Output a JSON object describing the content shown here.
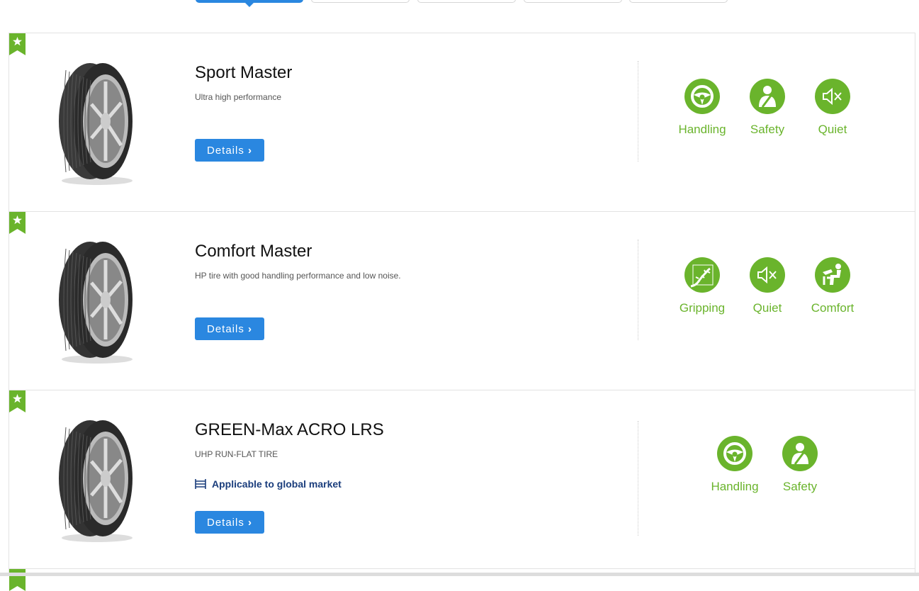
{
  "tabs": [
    {
      "active": true
    },
    {
      "active": false
    },
    {
      "active": false
    },
    {
      "active": false
    },
    {
      "active": false
    }
  ],
  "colors": {
    "accent_blue": "#2a87e0",
    "feature_green": "#6ab42c",
    "market_text": "#1a3d7c"
  },
  "products": [
    {
      "title": "Sport Master",
      "subtitle": "Ultra high performance",
      "details_label": "Details",
      "features": [
        {
          "label": "Handling",
          "icon": "steering-wheel-icon"
        },
        {
          "label": "Safety",
          "icon": "seatbelt-person-icon"
        },
        {
          "label": "Quiet",
          "icon": "speaker-mute-icon"
        }
      ]
    },
    {
      "title": "Comfort Master",
      "subtitle": "HP tire with good handling performance and low noise.",
      "details_label": "Details",
      "features": [
        {
          "label": "Gripping",
          "icon": "gecko-icon"
        },
        {
          "label": "Quiet",
          "icon": "speaker-mute-icon"
        },
        {
          "label": "Comfort",
          "icon": "reclining-seat-icon"
        }
      ]
    },
    {
      "title": "GREEN-Max ACRO LRS",
      "subtitle": "UHP RUN-FLAT TIRE",
      "market": "Applicable to global market",
      "details_label": "Details",
      "features": [
        {
          "label": "Handling",
          "icon": "steering-wheel-icon"
        },
        {
          "label": "Safety",
          "icon": "seatbelt-person-icon"
        }
      ]
    }
  ]
}
